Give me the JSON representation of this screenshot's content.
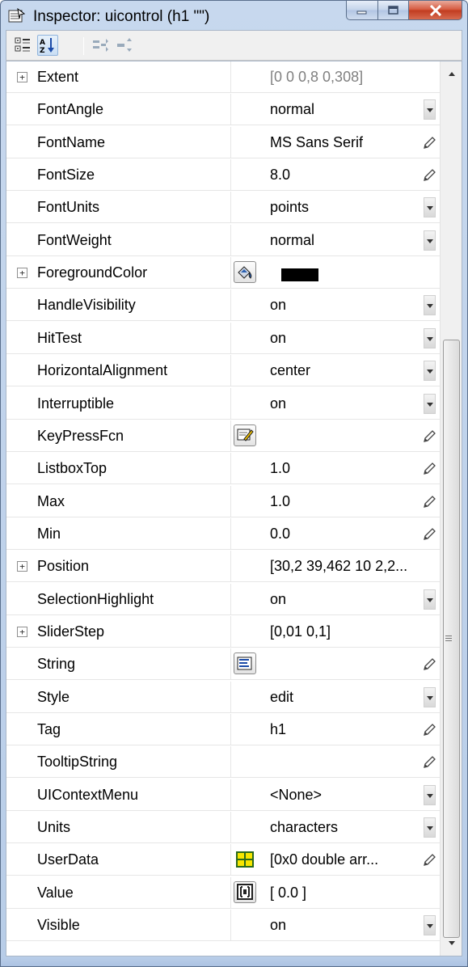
{
  "window": {
    "title": "Inspector:  uicontrol (h1 \"\")"
  },
  "toolbar": {
    "buttons": [
      {
        "icon": "categorized-view-icon",
        "active": false
      },
      {
        "icon": "sort-alphabetical-icon",
        "active": true
      },
      {
        "icon": "expand-all-icon",
        "active": false
      },
      {
        "icon": "collapse-all-icon",
        "active": false
      }
    ]
  },
  "properties": [
    {
      "name": "Extent",
      "value": "[0 0 0,8 0,308]",
      "expandable": true,
      "value_dim": true,
      "action": "none",
      "editor": null
    },
    {
      "name": "FontAngle",
      "value": "normal",
      "expandable": false,
      "action": "dropdown",
      "editor": null
    },
    {
      "name": "FontName",
      "value": "MS Sans Serif",
      "expandable": false,
      "action": "pencil",
      "editor": null
    },
    {
      "name": "FontSize",
      "value": "8.0",
      "expandable": false,
      "action": "pencil",
      "editor": null
    },
    {
      "name": "FontUnits",
      "value": "points",
      "expandable": false,
      "action": "dropdown",
      "editor": null
    },
    {
      "name": "FontWeight",
      "value": "normal",
      "expandable": false,
      "action": "dropdown",
      "editor": null
    },
    {
      "name": "ForegroundColor",
      "value": "",
      "expandable": true,
      "action": "none",
      "editor": "color-picker-icon",
      "swatch": "#000000"
    },
    {
      "name": "HandleVisibility",
      "value": "on",
      "expandable": false,
      "action": "dropdown",
      "editor": null
    },
    {
      "name": "HitTest",
      "value": "on",
      "expandable": false,
      "action": "dropdown",
      "editor": null
    },
    {
      "name": "HorizontalAlignment",
      "value": "center",
      "expandable": false,
      "action": "dropdown",
      "editor": null
    },
    {
      "name": "Interruptible",
      "value": "on",
      "expandable": false,
      "action": "dropdown",
      "editor": null
    },
    {
      "name": "KeyPressFcn",
      "value": "",
      "expandable": false,
      "action": "pencil",
      "editor": "callback-editor-icon"
    },
    {
      "name": "ListboxTop",
      "value": "1.0",
      "expandable": false,
      "action": "pencil",
      "editor": null
    },
    {
      "name": "Max",
      "value": "1.0",
      "expandable": false,
      "action": "pencil",
      "editor": null
    },
    {
      "name": "Min",
      "value": "0.0",
      "expandable": false,
      "action": "pencil",
      "editor": null
    },
    {
      "name": "Position",
      "value": "[30,2 39,462 10 2,2...",
      "expandable": true,
      "action": "none",
      "editor": null
    },
    {
      "name": "SelectionHighlight",
      "value": "on",
      "expandable": false,
      "action": "dropdown",
      "editor": null
    },
    {
      "name": "SliderStep",
      "value": "[0,01 0,1]",
      "expandable": true,
      "action": "none",
      "editor": null
    },
    {
      "name": "String",
      "value": "",
      "expandable": false,
      "action": "pencil",
      "editor": "text-editor-icon"
    },
    {
      "name": "Style",
      "value": "edit",
      "expandable": false,
      "action": "dropdown",
      "editor": null
    },
    {
      "name": "Tag",
      "value": "h1",
      "expandable": false,
      "action": "pencil",
      "editor": null
    },
    {
      "name": "TooltipString",
      "value": "",
      "expandable": false,
      "action": "pencil",
      "editor": null
    },
    {
      "name": "UIContextMenu",
      "value": "<None>",
      "expandable": false,
      "action": "dropdown",
      "editor": null
    },
    {
      "name": "Units",
      "value": "characters",
      "expandable": false,
      "action": "dropdown",
      "editor": null
    },
    {
      "name": "UserData",
      "value": "[0x0  double arr...",
      "expandable": false,
      "action": "pencil",
      "editor": "array-editor-icon"
    },
    {
      "name": "Value",
      "value": "[ 0.0 ]",
      "expandable": false,
      "action": "none",
      "editor": "value-editor-icon"
    },
    {
      "name": "Visible",
      "value": "on",
      "expandable": false,
      "action": "dropdown",
      "editor": null
    }
  ]
}
